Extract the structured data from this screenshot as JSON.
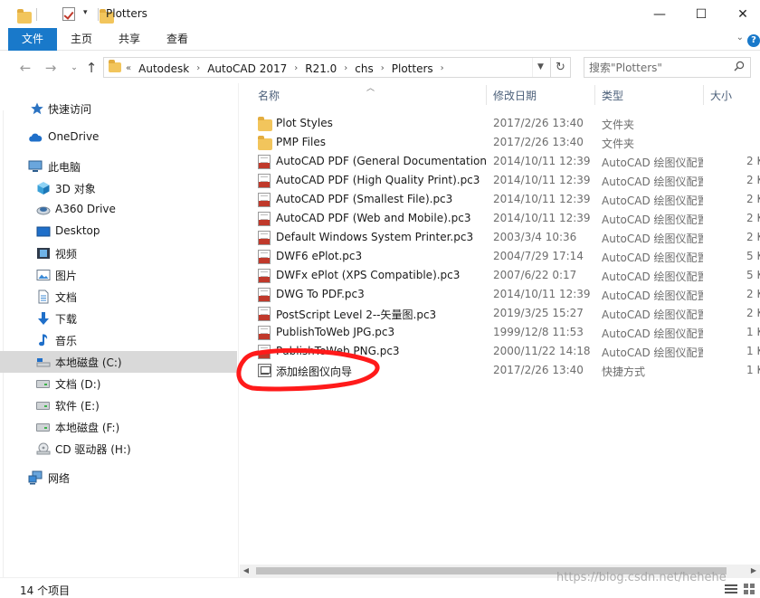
{
  "window": {
    "title": "Plotters",
    "minimize": "—",
    "maximize": "☐",
    "close": "✕"
  },
  "ribbon": {
    "tabs": [
      "文件",
      "主页",
      "共享",
      "查看"
    ],
    "help": "?"
  },
  "address": {
    "overflow": "«",
    "crumbs": [
      "Autodesk",
      "AutoCAD 2017",
      "R21.0",
      "chs",
      "Plotters"
    ]
  },
  "search": {
    "placeholder": "搜索\"Plotters\""
  },
  "sidebar": {
    "items": [
      {
        "label": "快速访问",
        "icon": "star-icon"
      },
      {
        "label": "OneDrive",
        "icon": "cloud-icon"
      },
      {
        "label": "此电脑",
        "icon": "computer-icon"
      },
      {
        "label": "3D 对象",
        "icon": "cube-icon"
      },
      {
        "label": "A360 Drive",
        "icon": "a360-icon"
      },
      {
        "label": "Desktop",
        "icon": "desktop-icon"
      },
      {
        "label": "视频",
        "icon": "video-icon"
      },
      {
        "label": "图片",
        "icon": "picture-icon"
      },
      {
        "label": "文档",
        "icon": "document-icon"
      },
      {
        "label": "下载",
        "icon": "download-icon"
      },
      {
        "label": "音乐",
        "icon": "music-icon"
      },
      {
        "label": "本地磁盘 (C:)",
        "icon": "drive-icon",
        "selected": true
      },
      {
        "label": "文档 (D:)",
        "icon": "drive-icon"
      },
      {
        "label": "软件 (E:)",
        "icon": "drive-icon"
      },
      {
        "label": "本地磁盘 (F:)",
        "icon": "drive-icon"
      },
      {
        "label": "CD 驱动器 (H:)",
        "icon": "cd-drive-icon"
      },
      {
        "label": "网络",
        "icon": "network-icon"
      }
    ]
  },
  "columns": {
    "name": "名称",
    "date": "修改日期",
    "type": "类型",
    "size": "大小"
  },
  "files": [
    {
      "name": "Plot Styles",
      "date": "2017/2/26 13:40",
      "type": "文件夹",
      "size": "",
      "kind": "folder"
    },
    {
      "name": "PMP Files",
      "date": "2017/2/26 13:40",
      "type": "文件夹",
      "size": "",
      "kind": "folder"
    },
    {
      "name": "AutoCAD PDF (General Documentation).pc3",
      "date": "2014/10/11 12:39",
      "type": "AutoCAD 绘图仪配置",
      "size": "2 K",
      "kind": "pc3"
    },
    {
      "name": "AutoCAD PDF (High Quality Print).pc3",
      "date": "2014/10/11 12:39",
      "type": "AutoCAD 绘图仪配置",
      "size": "2 K",
      "kind": "pc3"
    },
    {
      "name": "AutoCAD PDF (Smallest File).pc3",
      "date": "2014/10/11 12:39",
      "type": "AutoCAD 绘图仪配置",
      "size": "2 K",
      "kind": "pc3"
    },
    {
      "name": "AutoCAD PDF (Web and Mobile).pc3",
      "date": "2014/10/11 12:39",
      "type": "AutoCAD 绘图仪配置",
      "size": "2 K",
      "kind": "pc3"
    },
    {
      "name": "Default Windows System Printer.pc3",
      "date": "2003/3/4 10:36",
      "type": "AutoCAD 绘图仪配置",
      "size": "2 K",
      "kind": "pc3"
    },
    {
      "name": "DWF6 ePlot.pc3",
      "date": "2004/7/29 17:14",
      "type": "AutoCAD 绘图仪配置",
      "size": "5 K",
      "kind": "pc3"
    },
    {
      "name": "DWFx ePlot (XPS Compatible).pc3",
      "date": "2007/6/22 0:17",
      "type": "AutoCAD 绘图仪配置",
      "size": "5 K",
      "kind": "pc3"
    },
    {
      "name": "DWG To PDF.pc3",
      "date": "2014/10/11 12:39",
      "type": "AutoCAD 绘图仪配置",
      "size": "2 K",
      "kind": "pc3"
    },
    {
      "name": "PostScript Level 2--矢量图.pc3",
      "date": "2019/3/25 15:27",
      "type": "AutoCAD 绘图仪配置",
      "size": "2 K",
      "kind": "pc3"
    },
    {
      "name": "PublishToWeb JPG.pc3",
      "date": "1999/12/8 11:53",
      "type": "AutoCAD 绘图仪配置",
      "size": "1 K",
      "kind": "pc3"
    },
    {
      "name": "PublishToWeb PNG.pc3",
      "date": "2000/11/22 14:18",
      "type": "AutoCAD 绘图仪配置",
      "size": "1 K",
      "kind": "pc3"
    },
    {
      "name": "添加绘图仪向导",
      "date": "2017/2/26 13:40",
      "type": "快捷方式",
      "size": "1 K",
      "kind": "shortcut"
    }
  ],
  "status": {
    "count": "14 个项目"
  },
  "watermark": "https://blog.csdn.net/hehehe",
  "colors": {
    "accent": "#1979ca",
    "selected": "#d9d9d9",
    "annotation": "#ff1a1a"
  }
}
